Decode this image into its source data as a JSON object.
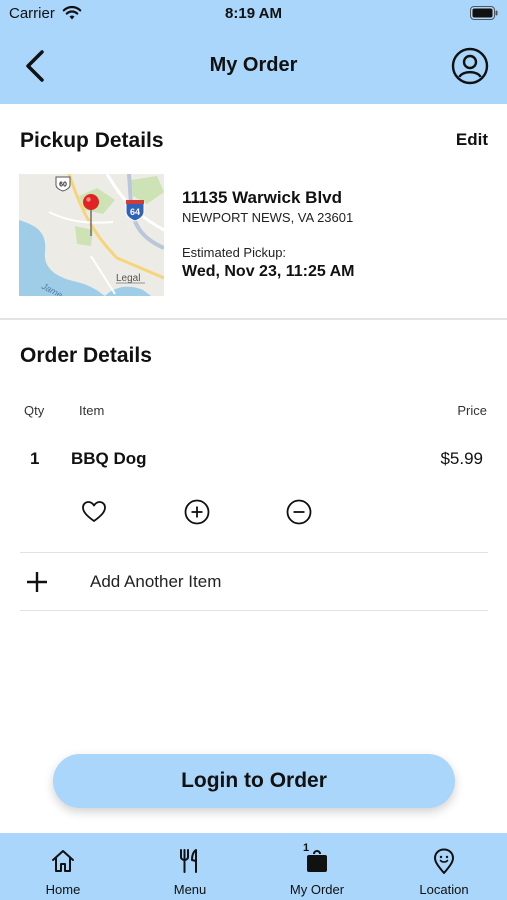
{
  "status_bar": {
    "carrier": "Carrier",
    "time": "8:19 AM"
  },
  "header": {
    "title": "My Order"
  },
  "pickup": {
    "heading": "Pickup Details",
    "edit_label": "Edit",
    "address_line1": "11135 Warwick Blvd",
    "address_line2": "NEWPORT NEWS, VA 23601",
    "estimated_label": "Estimated Pickup:",
    "estimated_time": "Wed, Nov 23, 11:25 AM",
    "map": {
      "route_60": "60",
      "route_64": "64",
      "legal": "Legal",
      "water_label": "Jame"
    }
  },
  "order": {
    "heading": "Order Details",
    "columns": {
      "qty": "Qty",
      "item": "Item",
      "price": "Price"
    },
    "items": [
      {
        "qty": "1",
        "name": "BBQ Dog",
        "price": "$5.99"
      }
    ],
    "add_item_label": "Add Another Item"
  },
  "login_button": "Login to Order",
  "tabs": [
    {
      "label": "Home",
      "icon": "home-icon"
    },
    {
      "label": "Menu",
      "icon": "utensils-icon"
    },
    {
      "label": "My Order",
      "icon": "order-bag-icon",
      "badge": "1"
    },
    {
      "label": "Location",
      "icon": "location-pin-icon"
    }
  ],
  "colors": {
    "accent": "#a9d6fa",
    "map_pin": "#e02424"
  }
}
